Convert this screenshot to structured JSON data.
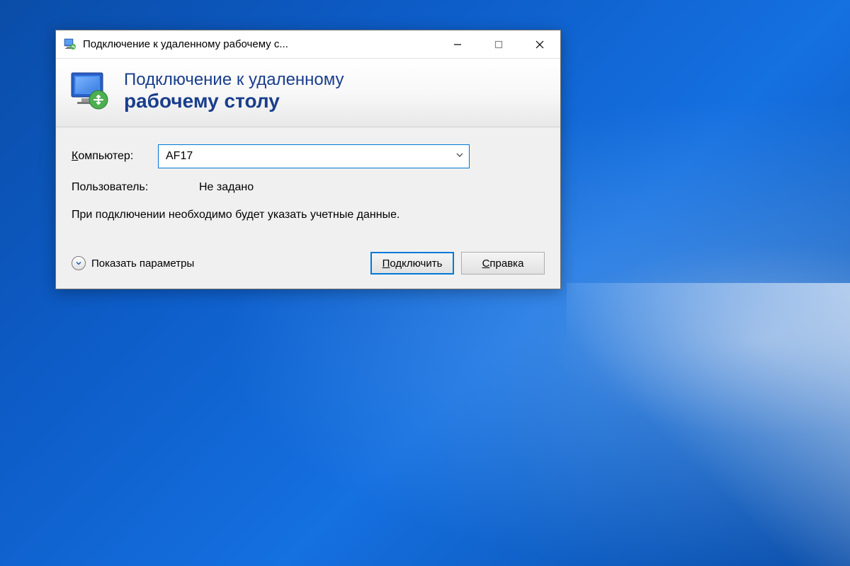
{
  "window": {
    "title": "Подключение к удаленному рабочему с..."
  },
  "header": {
    "line1": "Подключение к удаленному",
    "line2": "рабочему столу"
  },
  "form": {
    "computer_label_prefix": "К",
    "computer_label_rest": "омпьютер:",
    "computer_value": "AF17",
    "user_label": "Пользователь:",
    "user_value": "Не задано",
    "info_text": "При подключении необходимо будет указать учетные данные."
  },
  "footer": {
    "show_options_prefix": "П",
    "show_options_rest": "оказать параметры",
    "connect_label_prefix": "П",
    "connect_label_rest": "одключить",
    "help_label_prefix": "С",
    "help_label_rest": "правка"
  }
}
